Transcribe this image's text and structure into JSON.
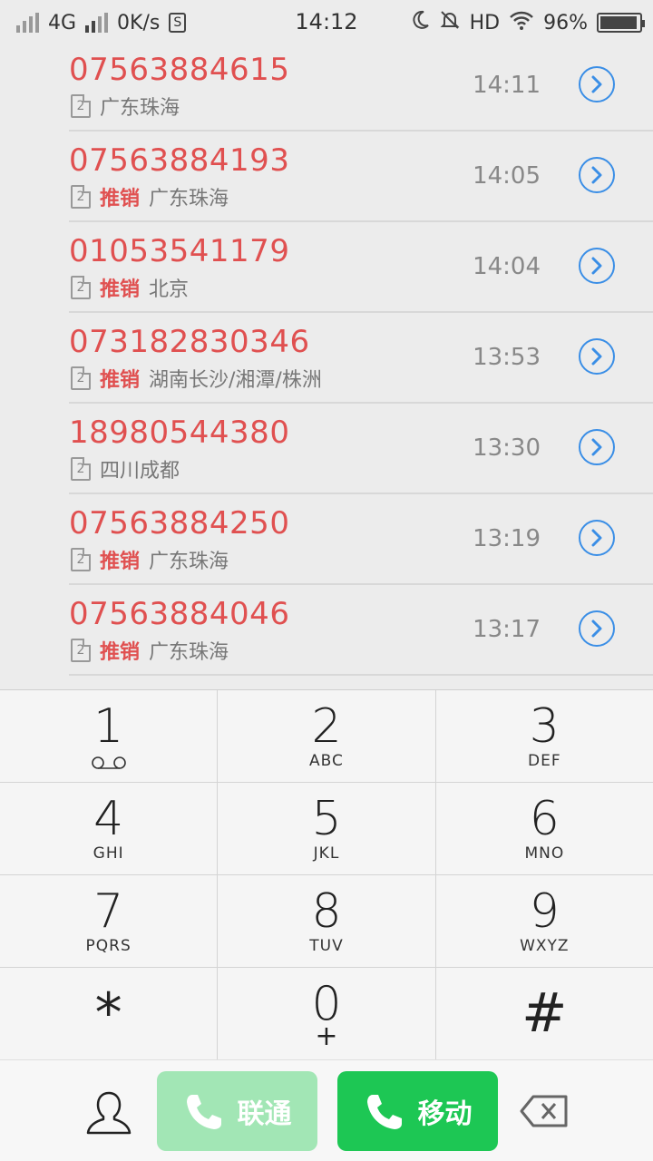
{
  "status_bar": {
    "network": "4G",
    "speed": "0K/s",
    "sim_badge": "S",
    "time": "14:12",
    "hd": "HD",
    "battery": "96%",
    "battery_level": 0.96
  },
  "calls": [
    {
      "number": "07563884615",
      "tag": "",
      "location": "广东珠海",
      "time": "14:11"
    },
    {
      "number": "07563884193",
      "tag": "推销",
      "location": "广东珠海",
      "time": "14:05"
    },
    {
      "number": "01053541179",
      "tag": "推销",
      "location": "北京",
      "time": "14:04"
    },
    {
      "number": "073182830346",
      "tag": "推销",
      "location": "湖南长沙/湘潭/株洲",
      "time": "13:53"
    },
    {
      "number": "18980544380",
      "tag": "",
      "location": "四川成都",
      "time": "13:30"
    },
    {
      "number": "07563884250",
      "tag": "推销",
      "location": "广东珠海",
      "time": "13:19"
    },
    {
      "number": "07563884046",
      "tag": "推销",
      "location": "广东珠海",
      "time": "13:17"
    }
  ],
  "sim_label": "2",
  "dialpad": {
    "keys": [
      {
        "digit": "1",
        "letters": ""
      },
      {
        "digit": "2",
        "letters": "ABC"
      },
      {
        "digit": "3",
        "letters": "DEF"
      },
      {
        "digit": "4",
        "letters": "GHI"
      },
      {
        "digit": "5",
        "letters": "JKL"
      },
      {
        "digit": "6",
        "letters": "MNO"
      },
      {
        "digit": "7",
        "letters": "PQRS"
      },
      {
        "digit": "8",
        "letters": "TUV"
      },
      {
        "digit": "9",
        "letters": "WXYZ"
      },
      {
        "digit": "*",
        "letters": ""
      },
      {
        "digit": "0",
        "letters": "+"
      },
      {
        "digit": "#",
        "letters": ""
      }
    ]
  },
  "bottom": {
    "unicom_label": "联通",
    "mobile_label": "移动"
  },
  "colors": {
    "missed_red": "#e05050",
    "accent_blue": "#3a8ee6",
    "call_green": "#1dc754",
    "call_green_light": "#a2e6b5"
  }
}
